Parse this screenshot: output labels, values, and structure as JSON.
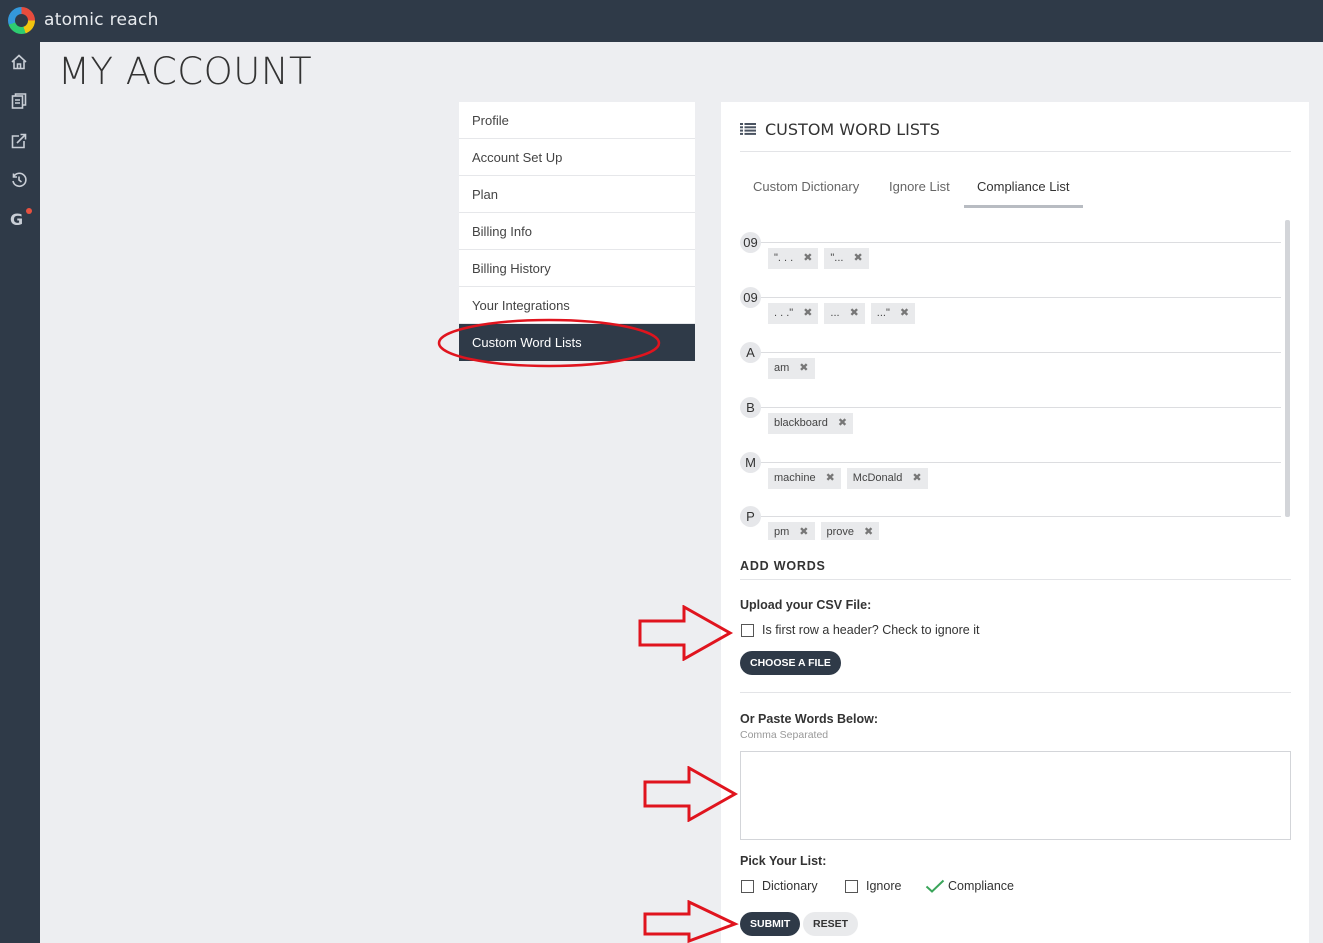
{
  "app": {
    "brand": "atomic reach"
  },
  "page": {
    "title": "MY ACCOUNT"
  },
  "account_menu": [
    {
      "label": "Profile"
    },
    {
      "label": "Account Set Up"
    },
    {
      "label": "Plan"
    },
    {
      "label": "Billing Info"
    },
    {
      "label": "Billing History"
    },
    {
      "label": "Your Integrations"
    },
    {
      "label": "Custom Word Lists",
      "active": true
    }
  ],
  "panel": {
    "title": "CUSTOM WORD LISTS",
    "tabs": [
      {
        "label": "Custom Dictionary"
      },
      {
        "label": "Ignore List"
      },
      {
        "label": "Compliance List",
        "active": true
      }
    ],
    "groups": [
      {
        "letter": "09",
        "words": [
          "\". . .",
          "\"..."
        ]
      },
      {
        "letter": "09",
        "words": [
          ". . .\"",
          "...",
          "...\""
        ]
      },
      {
        "letter": "A",
        "words": [
          "am"
        ]
      },
      {
        "letter": "B",
        "words": [
          "blackboard"
        ]
      },
      {
        "letter": "M",
        "words": [
          "machine",
          "McDonald"
        ]
      },
      {
        "letter": "P",
        "words": [
          "pm",
          "prove"
        ]
      }
    ],
    "remove_glyph": "✖"
  },
  "add_words": {
    "title": "ADD WORDS",
    "upload_label": "Upload your CSV File:",
    "header_checkbox_label": "Is first row a header? Check to ignore it",
    "choose_file_label": "CHOOSE A FILE",
    "paste_label": "Or Paste Words Below:",
    "paste_hint": "Comma Separated",
    "textarea_value": "",
    "pick_list_label": "Pick Your List:",
    "list_options": [
      {
        "label": "Dictionary",
        "checked": false
      },
      {
        "label": "Ignore",
        "checked": false
      },
      {
        "label": "Compliance",
        "checked": true
      }
    ],
    "submit_label": "SUBMIT",
    "reset_label": "RESET"
  },
  "colors": {
    "sidebar": "#2f3a48",
    "annotation_red": "#e0141e",
    "check_green": "#3aa55a"
  },
  "sidebar_icons": [
    "home-icon",
    "clipboard-icon",
    "share-icon",
    "history-icon",
    "google-icon"
  ]
}
